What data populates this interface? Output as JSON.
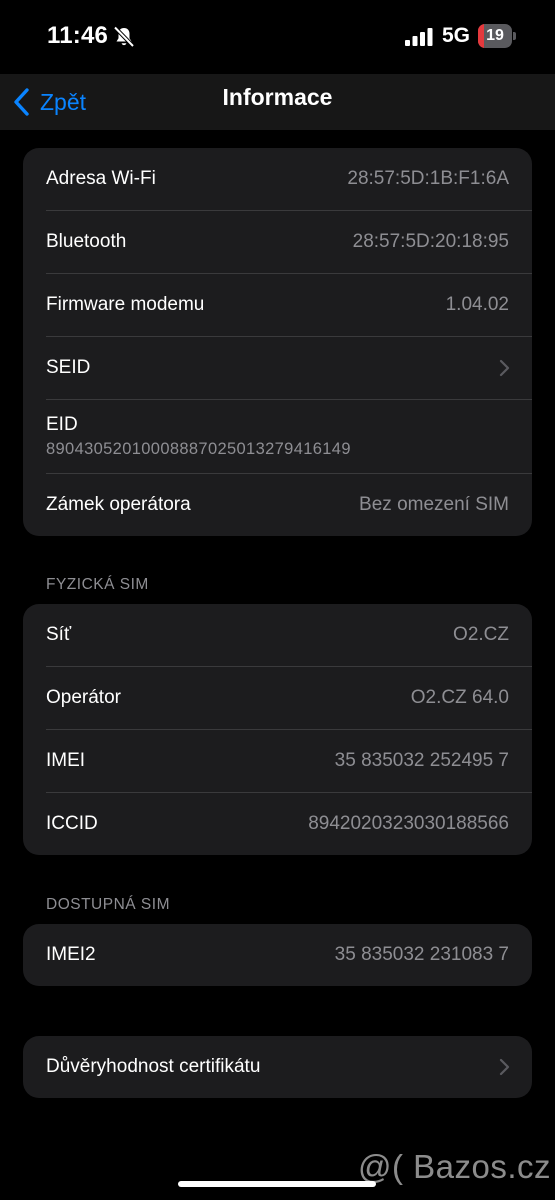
{
  "status_bar": {
    "time": "11:46",
    "network": "5G",
    "battery_level": "19",
    "battery_fraction": 0.19,
    "mute_icon": "bell-slash-icon",
    "signal_icon": "cellular-signal-icon"
  },
  "nav": {
    "back_label": "Zpět",
    "title": "Informace",
    "accent_color": "#0a84ff"
  },
  "group1": {
    "wifi": {
      "label": "Adresa Wi-Fi",
      "value": "28:57:5D:1B:F1:6A"
    },
    "bluetooth": {
      "label": "Bluetooth",
      "value": "28:57:5D:20:18:95"
    },
    "modem": {
      "label": "Firmware modemu",
      "value": "1.04.02"
    },
    "seid": {
      "label": "SEID"
    },
    "eid": {
      "label": "EID",
      "value": "89043052010008887025013279416149"
    },
    "carrier_lock": {
      "label": "Zámek operátora",
      "value": "Bez omezení SIM"
    }
  },
  "physical_sim": {
    "header": "FYZICKÁ SIM",
    "network": {
      "label": "Síť",
      "value": "O2.CZ"
    },
    "carrier": {
      "label": "Operátor",
      "value": "O2.CZ 64.0"
    },
    "imei": {
      "label": "IMEI",
      "value": "35 835032 252495 7"
    },
    "iccid": {
      "label": "ICCID",
      "value": "8942020323030188566"
    }
  },
  "available_sim": {
    "header": "DOSTUPNÁ SIM",
    "imei2": {
      "label": "IMEI2",
      "value": "35 835032 231083 7"
    }
  },
  "certificates": {
    "label": "Důvěryhodnost certifikátu"
  },
  "watermark": "@( Bazos.cz"
}
